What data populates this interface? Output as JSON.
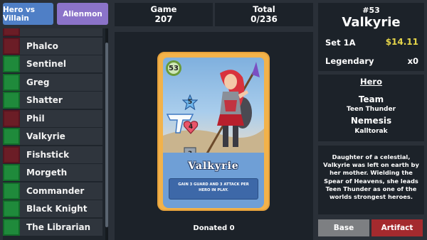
{
  "tabs": {
    "hero_villain": "Hero vs Villain",
    "alienmon": "Alienmon"
  },
  "list": [
    {
      "label": "",
      "status": "red"
    },
    {
      "label": "Phalco",
      "status": "red"
    },
    {
      "label": "Sentinel",
      "status": "green"
    },
    {
      "label": "Greg",
      "status": "green"
    },
    {
      "label": "Shatter",
      "status": "green"
    },
    {
      "label": "Phil",
      "status": "red"
    },
    {
      "label": "Valkyrie",
      "status": "green"
    },
    {
      "label": "Fishstick",
      "status": "red"
    },
    {
      "label": "Morgeth",
      "status": "green"
    },
    {
      "label": "Commander",
      "status": "green"
    },
    {
      "label": "Black Knight",
      "status": "green"
    },
    {
      "label": "The Librarian",
      "status": "green"
    }
  ],
  "stats": {
    "game_label": "Game",
    "game_value": "207",
    "total_label": "Total",
    "total_value": "0/236"
  },
  "card": {
    "name": "Valkyrie",
    "cost": "53",
    "guard": "5",
    "attack": "4",
    "third": "3",
    "ability": "GAIN 3 GUARD AND 3 ATTACK PER HERO IN PLAY."
  },
  "donated": "Donated 0",
  "detail": {
    "number": "#53",
    "title": "Valkyrie",
    "set": "Set 1A",
    "price": "$14.11",
    "rarity": "Legendary",
    "rarity_count": "x0"
  },
  "info": {
    "kind": "Hero",
    "team_label": "Team",
    "team_value": "Teen Thunder",
    "nemesis_label": "Nemesis",
    "nemesis_value": "Kalltorak"
  },
  "bio": "Daughter of a celestial, Valkyrie was left on earth by her mother. Wielding the Spear of Heavens, she leads Teen Thunder as one of the worlds strongest heroes.",
  "buttons": {
    "base": "Base",
    "artifact": "Artifact"
  },
  "colors": {
    "background": "#2a3038",
    "panel": "#1c2229",
    "hero_tab": "#4f7fc6",
    "alien_tab": "#8b73c9",
    "owned_green": "#1f8a3b",
    "unowned_red": "#6b1d26",
    "price_gold": "#e6d64a",
    "artifact_red": "#a42a2e",
    "base_grey": "#7d7f82",
    "card_gold": "#f2b24a",
    "card_blue": "#6f9fd6"
  }
}
